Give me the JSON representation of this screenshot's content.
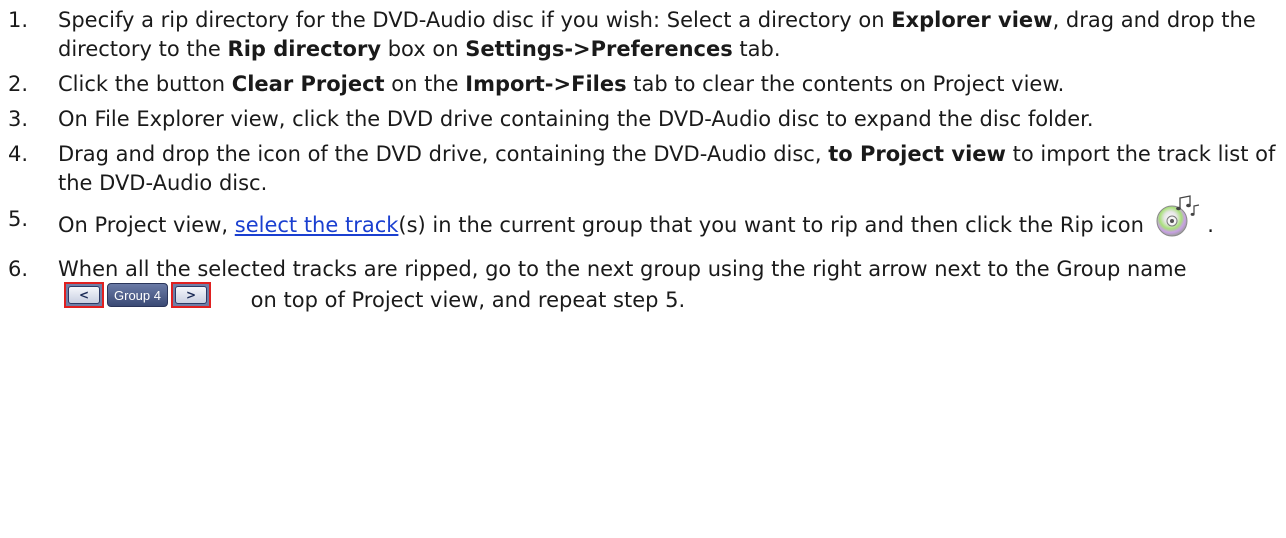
{
  "steps": [
    {
      "number": "1.",
      "parts": {
        "a": "Specify a rip directory for the DVD-Audio disc if you wish: Select a directory on ",
        "b": "Explorer view",
        "c": ", drag and drop the directory to the ",
        "d": "Rip directory",
        "e": " box on ",
        "f": "Settings->Preferences",
        "g": " tab."
      }
    },
    {
      "number": "2.",
      "parts": {
        "a": "Click the button ",
        "b": "Clear Project",
        "c": " on the ",
        "d": "Import->Files",
        "e": " tab to clear the contents on Project view."
      }
    },
    {
      "number": "3.",
      "parts": {
        "a": "On File Explorer view, click the DVD drive containing the DVD-Audio disc to expand the disc folder."
      }
    },
    {
      "number": "4.",
      "parts": {
        "a": "Drag and drop the icon of the DVD drive, containing the DVD-Audio disc, ",
        "b": "to Project view",
        "c": " to import the track list of the DVD-Audio disc."
      }
    },
    {
      "number": "5.",
      "parts": {
        "a": "On Project view, ",
        "link": "select the track",
        "b": "(s) in the current group that you want to rip and then click the Rip icon",
        "c": "."
      },
      "icon": "rip-cd-music-icon"
    },
    {
      "number": "6.",
      "parts": {
        "a": "When all the selected tracks are ripped, go to the next group using the right arrow next to the Group name",
        "b": "on top of Project view, and repeat step 5."
      },
      "group_nav": {
        "prev_label": "<",
        "group_label": "Group 4",
        "next_label": ">"
      }
    }
  ],
  "colors": {
    "link": "#1a3fd0",
    "highlight_border": "#e02020",
    "text": "#1a1a1a"
  }
}
